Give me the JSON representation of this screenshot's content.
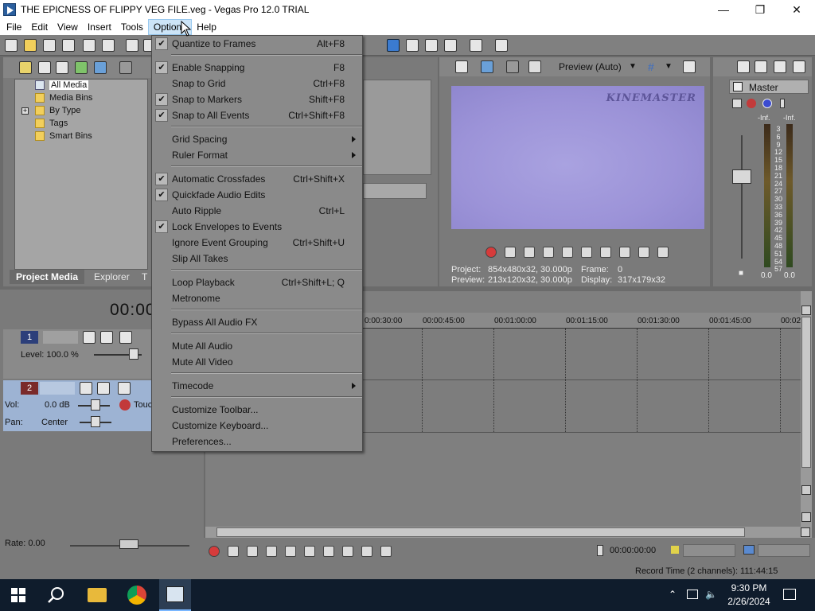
{
  "window": {
    "title": "THE EPICNESS OF FLIPPY VEG FILE.veg - Vegas Pro 12.0 TRIAL"
  },
  "menubar": [
    "File",
    "Edit",
    "View",
    "Insert",
    "Tools",
    "Options",
    "Help"
  ],
  "options_menu": {
    "quantize": {
      "label": "Quantize to Frames",
      "shortcut": "Alt+F8"
    },
    "enable_snapping": {
      "label": "Enable Snapping",
      "shortcut": "F8"
    },
    "snap_grid": {
      "label": "Snap to Grid",
      "shortcut": "Ctrl+F8"
    },
    "snap_markers": {
      "label": "Snap to Markers",
      "shortcut": "Shift+F8"
    },
    "snap_events": {
      "label": "Snap to All Events",
      "shortcut": "Ctrl+Shift+F8"
    },
    "grid_spacing": {
      "label": "Grid Spacing"
    },
    "ruler_format": {
      "label": "Ruler Format"
    },
    "auto_crossfades": {
      "label": "Automatic Crossfades",
      "shortcut": "Ctrl+Shift+X"
    },
    "quickfade": {
      "label": "Quickfade Audio Edits"
    },
    "auto_ripple": {
      "label": "Auto Ripple",
      "shortcut": "Ctrl+L"
    },
    "lock_envelopes": {
      "label": "Lock Envelopes to Events"
    },
    "ignore_grouping": {
      "label": "Ignore Event Grouping",
      "shortcut": "Ctrl+Shift+U"
    },
    "slip_takes": {
      "label": "Slip All Takes"
    },
    "loop_playback": {
      "label": "Loop Playback",
      "shortcut": "Ctrl+Shift+L; Q"
    },
    "metronome": {
      "label": "Metronome"
    },
    "bypass_fx": {
      "label": "Bypass All Audio FX"
    },
    "mute_audio": {
      "label": "Mute All Audio"
    },
    "mute_video": {
      "label": "Mute All Video"
    },
    "timecode": {
      "label": "Timecode"
    },
    "cust_toolbar": {
      "label": "Customize Toolbar..."
    },
    "cust_keyboard": {
      "label": "Customize Keyboard..."
    },
    "preferences": {
      "label": "Preferences..."
    }
  },
  "media": {
    "tree": [
      "All Media",
      "Media Bins",
      "By Type",
      "Tags",
      "Smart Bins"
    ],
    "tabs": [
      "Project Media",
      "Explorer",
      "T"
    ]
  },
  "preview": {
    "mode": "Preview (Auto)",
    "watermark": "KINEMASTER",
    "project_label": "Project:",
    "project_value": "854x480x32, 30.000p",
    "frame_label": "Frame:",
    "frame_value": "0",
    "preview_label": "Preview:",
    "preview_value": "213x120x32, 30.000p",
    "display_label": "Display:",
    "display_value": "317x179x32"
  },
  "mixer": {
    "master": "Master",
    "inf_left": "-Inf.",
    "inf_right": "-Inf.",
    "scale": [
      "3",
      "6",
      "9",
      "12",
      "15",
      "18",
      "21",
      "24",
      "27",
      "30",
      "33",
      "36",
      "39",
      "42",
      "45",
      "48",
      "51",
      "54",
      "57"
    ],
    "bottom_left": "0.0",
    "bottom_right": "0.0"
  },
  "timeline": {
    "timecode": "00:00",
    "ruler": [
      "0:00:30:00",
      "00:00:45:00",
      "00:01:00:00",
      "00:01:15:00",
      "00:01:30:00",
      "00:01:45:00",
      "00:02"
    ]
  },
  "tracks": {
    "video": {
      "num": "1",
      "level_label": "Level: 100.0 %"
    },
    "audio": {
      "num": "2",
      "vol_label": "Vol:",
      "vol_value": "0.0 dB",
      "pan_label": "Pan:",
      "pan_value": "Center",
      "touch": "Touc"
    }
  },
  "bottom": {
    "rate": "Rate: 0.00",
    "timecode": "00:00:00:00",
    "record_time": "Record Time (2 channels): 111:44:15"
  },
  "taskbar": {
    "time": "9:30 PM",
    "date": "2/26/2024"
  }
}
